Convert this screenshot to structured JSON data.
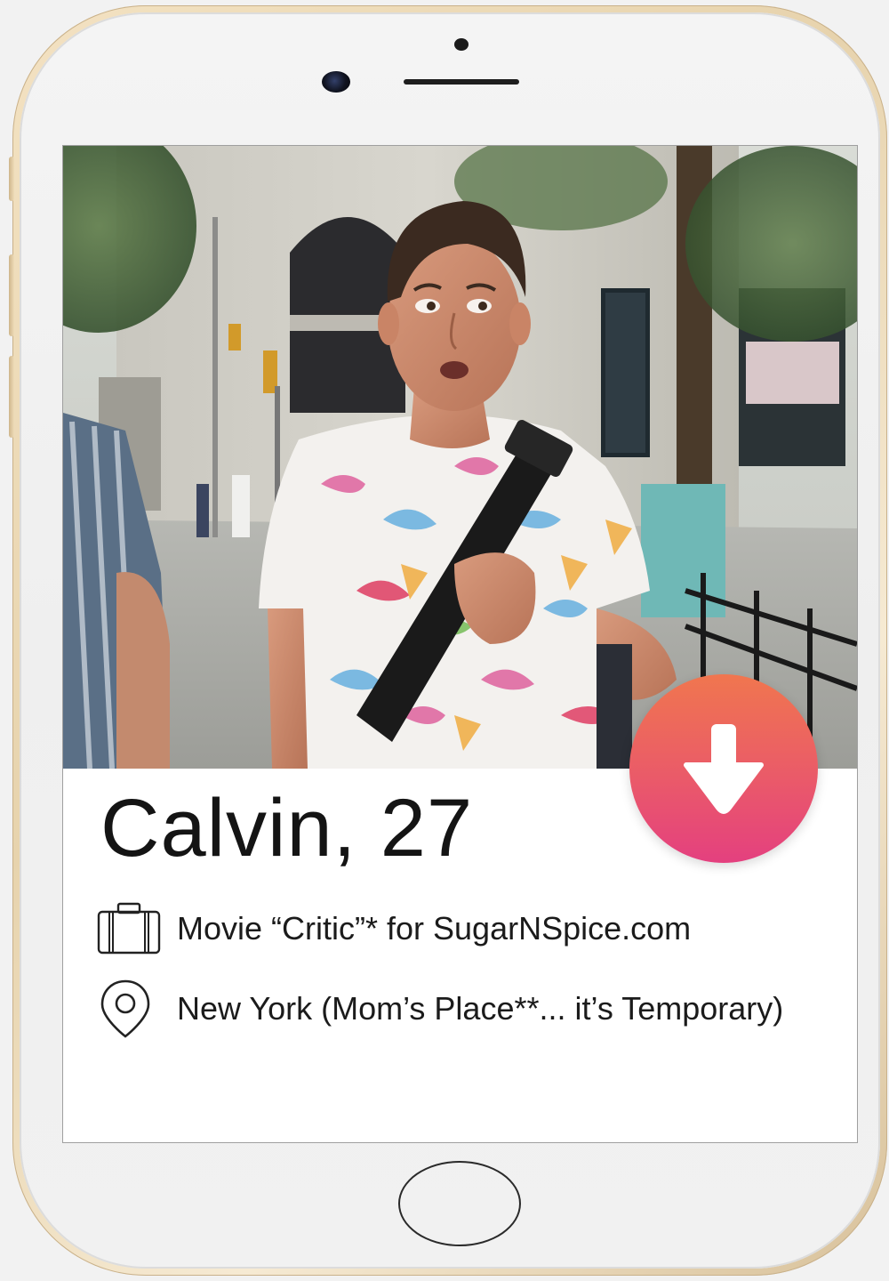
{
  "profile": {
    "name_age": "Calvin, 27",
    "job": "Movie “Critic”* for SugarNSpice.com",
    "location": "New York (Mom’s Place**... it’s Temporary)"
  },
  "icons": {
    "job": "briefcase-icon",
    "location": "location-pin-icon",
    "action": "arrow-down-icon"
  },
  "colors": {
    "action_gradient_top": "#f0764f",
    "action_gradient_bottom": "#e4407f",
    "phone_frame": "#e7d3ad"
  }
}
